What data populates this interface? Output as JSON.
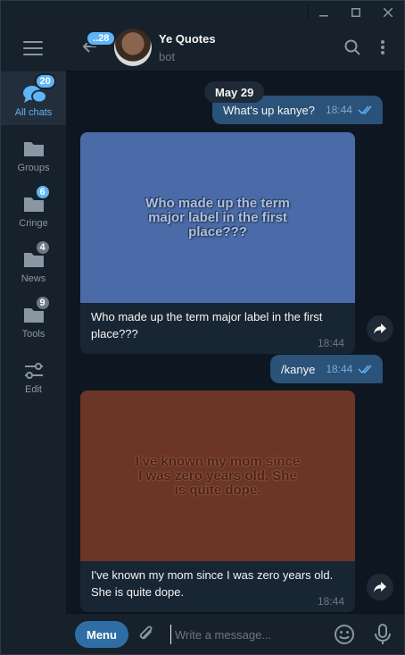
{
  "sidebar": {
    "folders": [
      {
        "label": "All chats",
        "badge": "20"
      },
      {
        "label": "Groups",
        "badge": ""
      },
      {
        "label": "Cringe",
        "badge": "6"
      },
      {
        "label": "News",
        "badge": "4"
      },
      {
        "label": "Tools",
        "badge": "9"
      },
      {
        "label": "Edit",
        "badge": ""
      }
    ]
  },
  "header": {
    "unread_badge": "..28",
    "title": "Ye Quotes",
    "subtitle": "bot"
  },
  "messages": {
    "date": "May 29",
    "out1": {
      "text": "What's up kanye?",
      "time": "18:44"
    },
    "in1": {
      "image_text": "Who made up the term major label in the first place???",
      "caption": "Who made up the term major label in the first place???",
      "time": "18:44"
    },
    "out2": {
      "text": "/kanye",
      "time": "18:44"
    },
    "in2": {
      "image_text": "I've known my mom since I was zero years old. She is quite dope.",
      "caption": "I've known my mom since I was zero years old. She is quite dope.",
      "time": "18:44"
    }
  },
  "composer": {
    "menu_label": "Menu",
    "placeholder": "Write a message..."
  },
  "colors": {
    "background": "#0e1621",
    "panel": "#17212b",
    "accent": "#5eb5f7",
    "outgoing_bubble": "#2b5278"
  }
}
